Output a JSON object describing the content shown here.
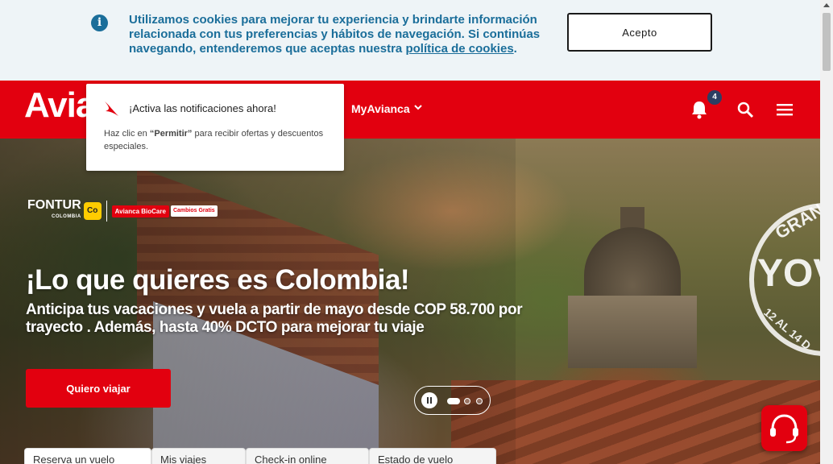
{
  "cookie": {
    "text": "Utilizamos cookies para mejorar tu experiencia y brindarte información relacionada con tus preferencias y hábitos de navegación. Si continúas navegando, entenderemos que aceptas nuestra ",
    "link": "política de cookies",
    "after": ".",
    "accept_label": "Acepto"
  },
  "header": {
    "logo": "Avianca",
    "myavianca": "MyAvianca",
    "notification_count": "4"
  },
  "notification_popup": {
    "title": "¡Activa las notificaciones ahora!",
    "body_pre": "Haz clic en ",
    "body_strong": "“Permitir”",
    "body_post": " para recibir ofertas y descuentos especiales."
  },
  "hero": {
    "partner_fontur": "FONTUR",
    "partner_fontur_sub": "COLOMBIA",
    "partner_co": "Co",
    "partner_biocare": "Avianca BioCare",
    "partner_gratis": "Cambios Gratis",
    "title": "¡Lo que quieres es Colombia!",
    "subtitle": "Anticipa tus vacaciones y vuela a partir de mayo desde COP 58.700 por trayecto . Además, hasta 40% DCTO para mejorar tu viaje",
    "cta": "Quiero viajar",
    "stamp_top": "GRAN",
    "stamp_main": "YOV",
    "stamp_small": "12 AL 14 D"
  },
  "tabs": [
    {
      "label": "Reserva un vuelo"
    },
    {
      "label": "Mis viajes"
    },
    {
      "label": "Check-in online"
    },
    {
      "label": "Estado de vuelo"
    }
  ],
  "colors": {
    "brand_red": "#e2000f",
    "cookie_blue": "#1b6e9a"
  },
  "icons": [
    "info-icon",
    "chevron-down-icon",
    "bell-icon",
    "search-icon",
    "hamburger-menu-icon",
    "pause-icon",
    "headset-help-icon"
  ]
}
